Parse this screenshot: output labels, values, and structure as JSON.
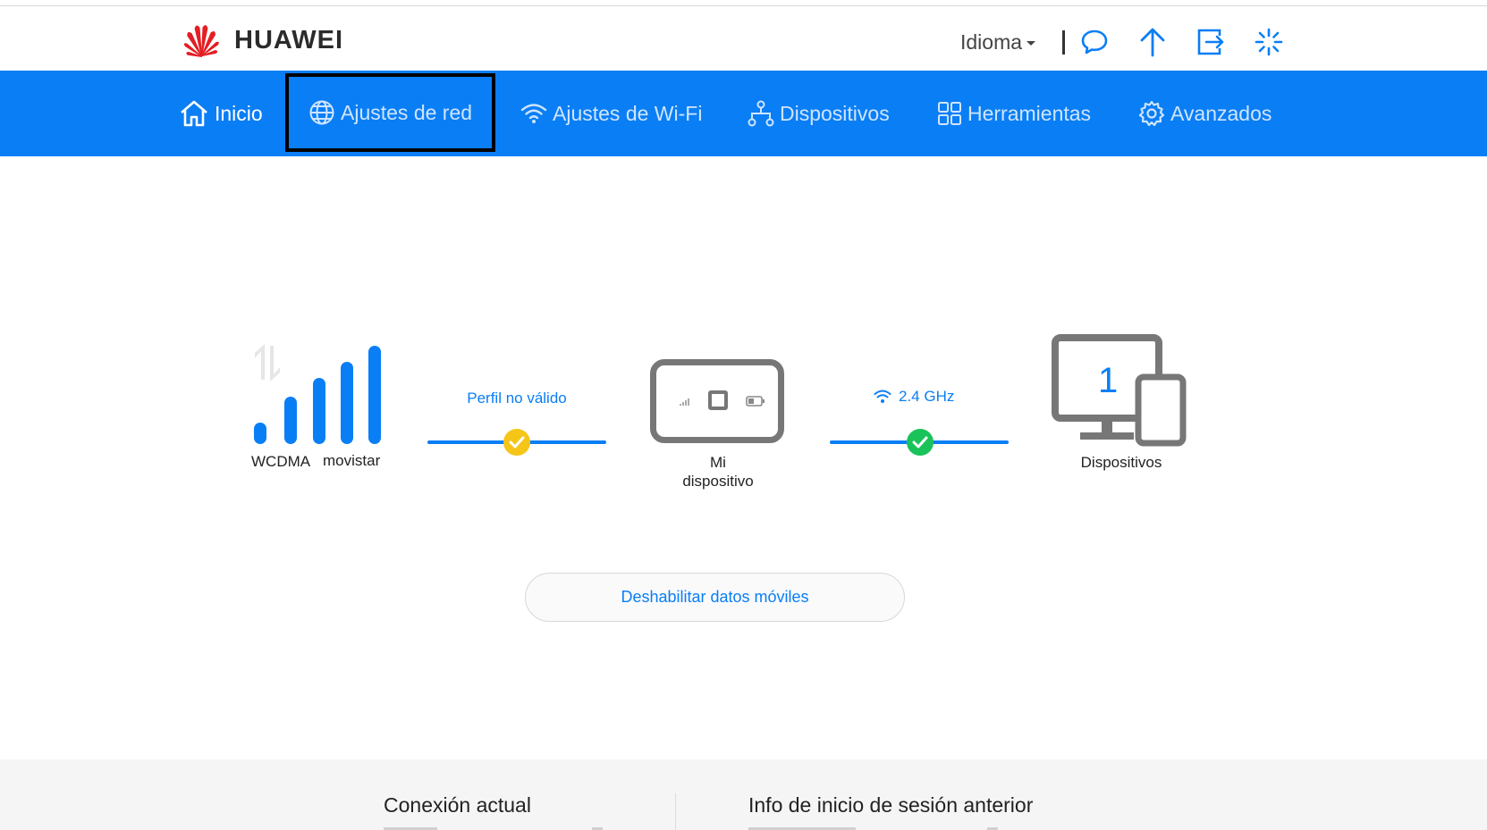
{
  "brand": {
    "name": "HUAWEI",
    "logo_color": "#e31e24"
  },
  "header": {
    "language_label": "Idioma",
    "icons": [
      "message-icon",
      "update-icon",
      "logout-icon",
      "loading-icon"
    ]
  },
  "nav": {
    "home": "Inicio",
    "network": "Ajustes de red",
    "wifi": "Ajustes de Wi-Fi",
    "devices": "Dispositivos",
    "tools": "Herramientas",
    "advanced": "Avanzados"
  },
  "status": {
    "network_type": "WCDMA",
    "operator": "movistar",
    "profile_status": "Perfil no válido",
    "my_device": "Mi dispositivo",
    "wifi_band": "2.4 GHz",
    "device_count": "1",
    "devices_label": "Dispositivos"
  },
  "actions": {
    "disable_data": "Deshabilitar datos móviles"
  },
  "footer": {
    "current_connection": "Conexión actual",
    "previous_login": "Info de inicio de sesión anterior"
  },
  "colors": {
    "primary": "#0a7ef5",
    "warning": "#f5c518",
    "success": "#19c35a",
    "device_gray": "#777777"
  }
}
